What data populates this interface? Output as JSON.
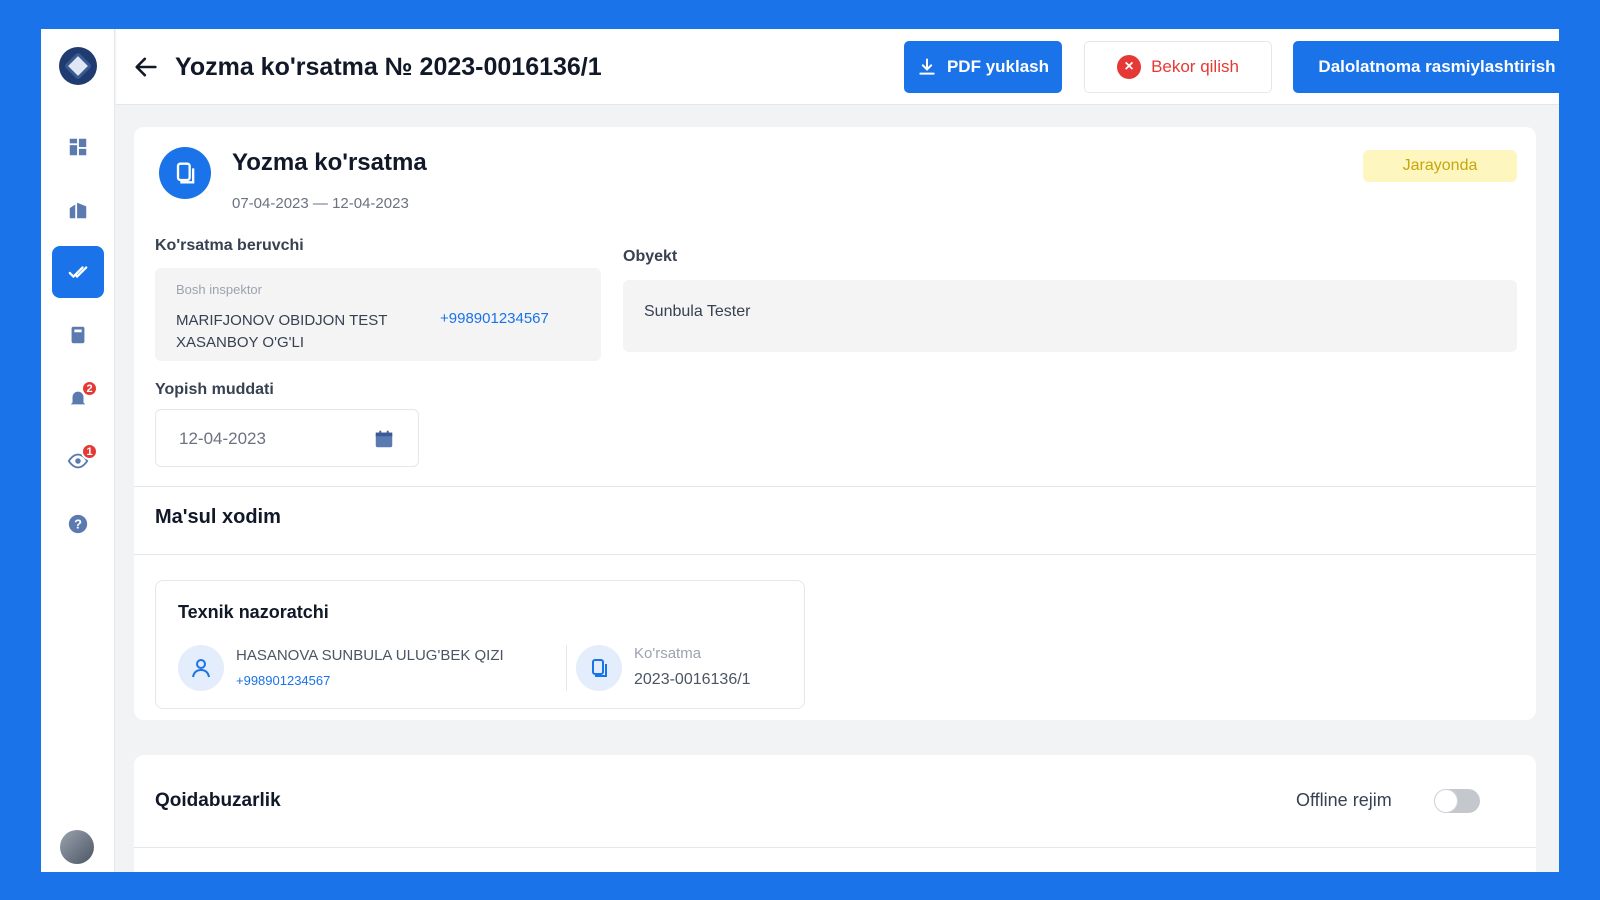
{
  "header": {
    "title": "Yozma ko'rsatma № 2023-0016136/1",
    "pdf_button": "PDF yuklash",
    "cancel_button": "Bekor qilish",
    "act_button": "Dalolatnoma rasmiylashtirish"
  },
  "sidebar": {
    "items": [
      {
        "icon": "dashboard-icon"
      },
      {
        "icon": "buildings-icon"
      },
      {
        "icon": "check-icon",
        "active": true
      },
      {
        "icon": "book-icon"
      },
      {
        "icon": "bell-icon",
        "badge": "2"
      },
      {
        "icon": "eye-icon",
        "badge": "1"
      },
      {
        "icon": "help-icon"
      }
    ]
  },
  "document": {
    "title": "Yozma ko'rsatma",
    "dates": "07-04-2023 — 12-04-2023",
    "status": "Jarayonda",
    "status_color": "#fdf6bf"
  },
  "issuer": {
    "label": "Ko'rsatma beruvchi",
    "role": "Bosh inspektor",
    "name": "MARIFJONOV OBIDJON TEST XASANBOY O'G'LI",
    "phone": "+998901234567"
  },
  "object": {
    "label": "Obyekt",
    "value": "Sunbula Tester"
  },
  "deadline": {
    "label": "Yopish muddati",
    "value": "12-04-2023"
  },
  "responsible": {
    "section_title": "Ma'sul xodim",
    "role": "Texnik nazoratchi",
    "name": "HASANOVA SUNBULA ULUG'BEK QIZI",
    "phone": "+998901234567",
    "ref_label": "Ko'rsatma",
    "ref_value": "2023-0016136/1"
  },
  "violations": {
    "section_title": "Qoidabuzarlik",
    "offline_label": "Offline rejim",
    "offline_enabled": false
  },
  "colors": {
    "accent": "#1a73e8",
    "danger": "#e53935"
  }
}
